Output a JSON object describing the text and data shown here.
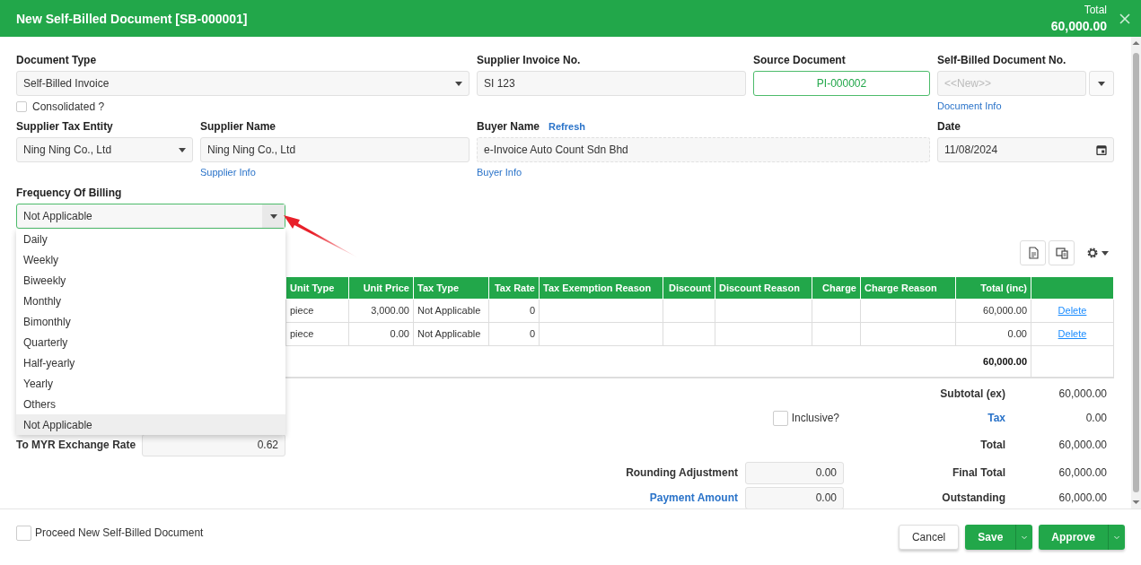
{
  "header": {
    "title": "New Self-Billed Document [SB-000001]",
    "total_label": "Total",
    "total_value": "60,000.00"
  },
  "form": {
    "document_type": {
      "label": "Document Type",
      "value": "Self-Billed Invoice"
    },
    "consolidated": {
      "label": "Consolidated ?",
      "checked": false
    },
    "supplier_invoice_no": {
      "label": "Supplier Invoice No.",
      "value": "SI 123"
    },
    "source_document": {
      "label": "Source Document",
      "value": "PI-000002"
    },
    "self_billed_document_no": {
      "label": "Self-Billed Document No.",
      "placeholder": "<<New>>",
      "link": "Document Info"
    },
    "supplier_tax_entity": {
      "label": "Supplier Tax Entity",
      "value": "Ning Ning Co., Ltd"
    },
    "supplier_name": {
      "label": "Supplier Name",
      "value": "Ning Ning Co., Ltd",
      "link": "Supplier Info"
    },
    "buyer_name": {
      "label": "Buyer Name",
      "action": "Refresh",
      "value": "e-Invoice Auto Count Sdn Bhd",
      "link": "Buyer Info"
    },
    "date": {
      "label": "Date",
      "value": "11/08/2024"
    },
    "frequency_of_billing": {
      "label": "Frequency Of Billing",
      "value": "Not Applicable",
      "expanded": true,
      "options": [
        {
          "label": "Daily",
          "selected": false
        },
        {
          "label": "Weekly",
          "selected": false
        },
        {
          "label": "Biweekly",
          "selected": false
        },
        {
          "label": "Monthly",
          "selected": false
        },
        {
          "label": "Bimonthly",
          "selected": false
        },
        {
          "label": "Quarterly",
          "selected": false
        },
        {
          "label": "Half-yearly",
          "selected": false
        },
        {
          "label": "Yearly",
          "selected": false
        },
        {
          "label": "Others",
          "selected": false
        },
        {
          "label": "Not Applicable",
          "selected": true
        }
      ]
    }
  },
  "table": {
    "columns": [
      {
        "label": "Unit Type",
        "numeric": false
      },
      {
        "label": "Unit Price",
        "numeric": true
      },
      {
        "label": "Tax Type",
        "numeric": false
      },
      {
        "label": "Tax Rate",
        "numeric": true
      },
      {
        "label": "Tax Exemption Reason",
        "numeric": false
      },
      {
        "label": "Discount",
        "numeric": true
      },
      {
        "label": "Discount Reason",
        "numeric": false
      },
      {
        "label": "Charge",
        "numeric": true
      },
      {
        "label": "Charge Reason",
        "numeric": false
      },
      {
        "label": "Total (inc)",
        "numeric": true
      }
    ],
    "rows": [
      {
        "cells": [
          "piece",
          "3,000.00",
          "Not Applicable",
          "0",
          "",
          "",
          "",
          "",
          "",
          "60,000.00"
        ],
        "action": "Delete"
      },
      {
        "cells": [
          "piece",
          "0.00",
          "Not Applicable",
          "0",
          "",
          "",
          "",
          "",
          "",
          "0.00"
        ],
        "action": "Delete"
      }
    ],
    "footer_total": "60,000.00"
  },
  "summary": {
    "exchange_rate": {
      "label": "To MYR Exchange Rate",
      "value": "0.62"
    },
    "inclusive": {
      "label": "Inclusive?",
      "checked": false
    },
    "rounding_adjustment": {
      "label": "Rounding Adjustment",
      "value": "0.00"
    },
    "payment_amount": {
      "label": "Payment Amount",
      "value": "0.00"
    },
    "totals": [
      {
        "label": "Subtotal (ex)",
        "value": "60,000.00",
        "kind": "text"
      },
      {
        "label": "Tax",
        "value": "0.00",
        "kind": "link"
      },
      {
        "label": "Total",
        "value": "60,000.00",
        "kind": "text"
      },
      {
        "label": "Final Total",
        "value": "60,000.00",
        "kind": "text"
      },
      {
        "label": "Outstanding",
        "value": "60,000.00",
        "kind": "text"
      }
    ]
  },
  "footer": {
    "proceed": {
      "label": "Proceed New Self-Billed Document",
      "checked": false
    },
    "buttons": [
      {
        "label": "Cancel",
        "kind": "plain"
      },
      {
        "label": "Save",
        "kind": "split"
      },
      {
        "label": "Approve",
        "kind": "split"
      }
    ]
  }
}
